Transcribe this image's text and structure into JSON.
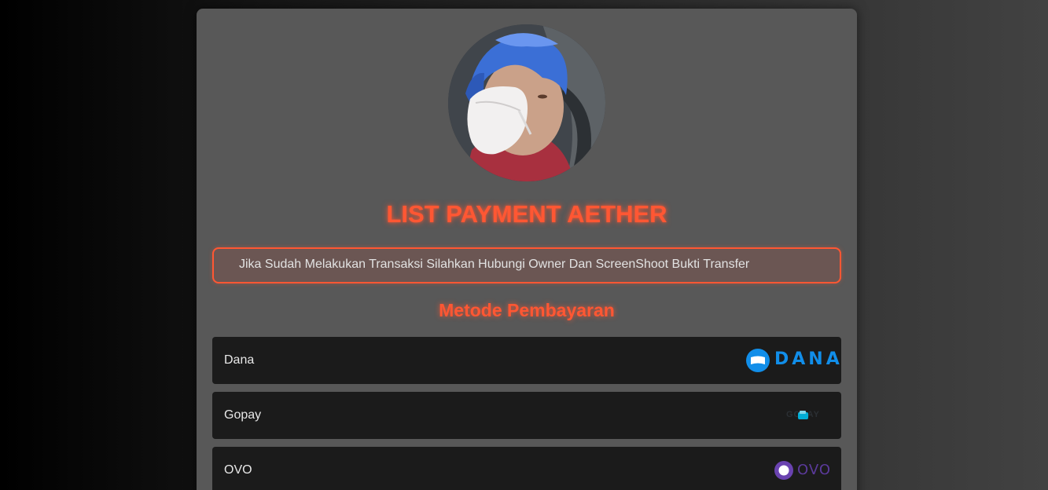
{
  "header": {
    "avatar_alt": "profile-photo",
    "title": "LIST PAYMENT AETHER"
  },
  "notice": {
    "text": "Jika Sudah Melakukan Transaksi Silahkan Hubungi Owner Dan ScreenShoot Bukti Transfer"
  },
  "payment": {
    "section_title": "Metode Pembayaran",
    "methods": [
      {
        "name": "Dana",
        "logo_icon": "dana-logo-icon",
        "logo_text": "DANA",
        "brand_color": "#118ee9"
      },
      {
        "name": "Gopay",
        "logo_icon": "gopay-logo-icon",
        "logo_text": "GOPAY",
        "brand_color": "#00aed6"
      },
      {
        "name": "OVO",
        "logo_icon": "ovo-logo-icon",
        "logo_text": "OVO",
        "brand_color": "#4c2a86"
      }
    ]
  },
  "colors": {
    "accent": "#ff5733",
    "card_bg": "#585858",
    "method_bg": "#1b1b1b"
  }
}
